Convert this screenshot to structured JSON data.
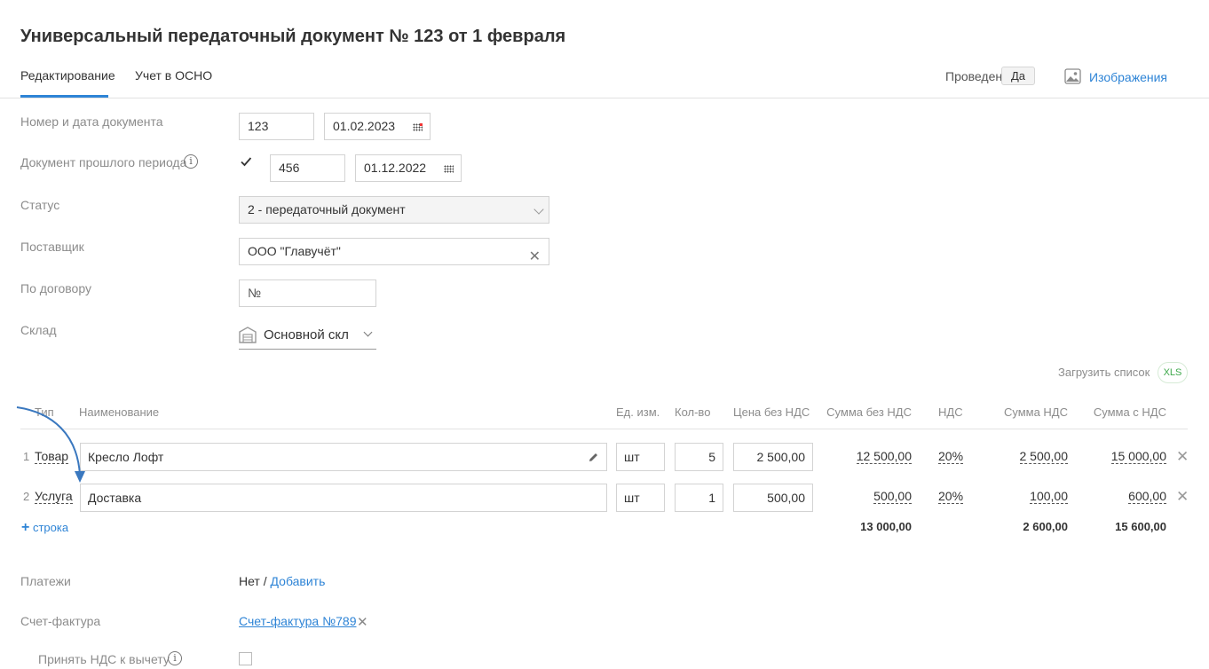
{
  "header": {
    "title": "Универсальный передаточный документ № 123 от 1 февраля",
    "tabs": [
      {
        "label": "Редактирование",
        "active": true
      },
      {
        "label": "Учет в ОСНО",
        "active": false
      }
    ],
    "posted_label": "Проведен",
    "posted_value": "Да",
    "images_label": "Изображения"
  },
  "form": {
    "doc_number_label": "Номер и дата документа",
    "doc_number": "123",
    "doc_date": "01.02.2023",
    "prev_period_label": "Документ прошлого периода",
    "prev_period_checked": true,
    "prev_number": "456",
    "prev_date": "01.12.2022",
    "status_label": "Статус",
    "status_value": "2 - передаточный документ",
    "supplier_label": "Поставщик",
    "supplier_value": "ООО \"Главучёт\"",
    "contract_label": "По договору",
    "contract_placeholder": "№",
    "warehouse_label": "Склад",
    "warehouse_value": "Основной скл"
  },
  "upload": {
    "label": "Загрузить список",
    "badge": "XLS"
  },
  "table": {
    "headers": {
      "type": "Тип",
      "name": "Наименование",
      "unit": "Ед. изм.",
      "qty": "Кол-во",
      "price": "Цена без НДС",
      "sum_no_vat": "Сумма без НДС",
      "vat": "НДС",
      "vat_sum": "Сумма НДС",
      "sum_vat": "Сумма с НДС"
    },
    "rows": [
      {
        "num": "1",
        "type": "Товар",
        "name": "Кресло Лофт",
        "unit": "шт",
        "qty": "5",
        "price": "2 500,00",
        "sum_no_vat": "12 500,00",
        "vat": "20%",
        "vat_sum": "2 500,00",
        "sum_vat": "15 000,00",
        "delete": "✕"
      },
      {
        "num": "2",
        "type": "Услуга",
        "name": "Доставка",
        "unit": "шт",
        "qty": "1",
        "price": "500,00",
        "sum_no_vat": "500,00",
        "vat": "20%",
        "vat_sum": "100,00",
        "sum_vat": "600,00",
        "delete": "✕"
      }
    ],
    "add_row_label": "строка",
    "totals": {
      "sum_no_vat": "13 000,00",
      "vat_sum": "2 600,00",
      "sum_vat": "15 600,00"
    }
  },
  "payments": {
    "label": "Платежи",
    "value": "Нет /",
    "add_label": "Добавить"
  },
  "invoice": {
    "label": "Счет-фактура",
    "link": "Счет-фактура №789",
    "remove": "✕"
  },
  "vat_deduction": {
    "label": "Принять НДС к вычету",
    "checked": false
  },
  "colors": {
    "accent": "#2e84d6",
    "xls_green": "#3ea84b"
  },
  "icons": {
    "images": "image-icon",
    "calendar": "calendar-icon",
    "info": "info-icon",
    "warehouse": "warehouse-icon",
    "pencil": "pencil-icon",
    "close": "close-icon"
  }
}
